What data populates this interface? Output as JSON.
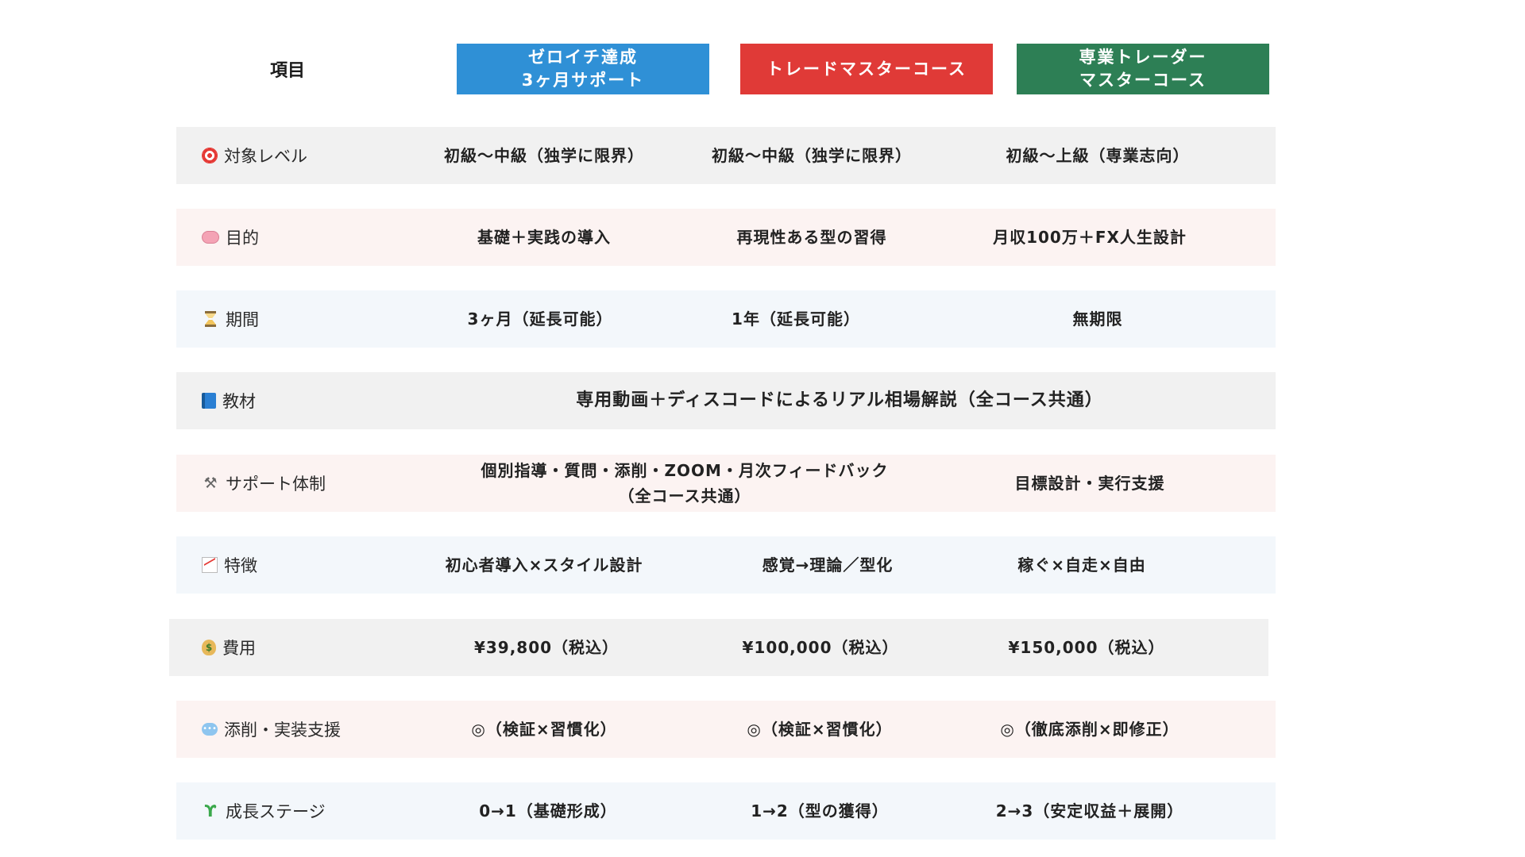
{
  "header": {
    "label": "項目",
    "courses": [
      {
        "title": "ゼロイチ達成\n3ヶ月サポート",
        "color": "#2f90d6"
      },
      {
        "title": "トレードマスターコース",
        "color": "#e03a37"
      },
      {
        "title": "専業トレーダー\nマスターコース",
        "color": "#2d7f55"
      }
    ]
  },
  "rows": [
    {
      "icon": "target-icon",
      "label": "対象レベル",
      "cells": [
        "初級〜中級（独学に限界）",
        "初級〜中級（独学に限界）",
        "初級〜上級（専業志向）"
      ]
    },
    {
      "icon": "brain-icon",
      "label": "目的",
      "cells": [
        "基礎＋実践の導入",
        "再現性ある型の習得",
        "月収100万＋FX人生設計"
      ]
    },
    {
      "icon": "hourglass-icon",
      "label": "期間",
      "cells": [
        "3ヶ月（延長可能）",
        "1年（延長可能）",
        "無期限"
      ]
    },
    {
      "icon": "book-icon",
      "label": "教材",
      "span": "専用動画＋ディスコードによるリアル相場解説（全コース共通）"
    },
    {
      "icon": "tools-icon",
      "label": "サポート体制",
      "span": "個別指導・質問・添削・ZOOM・月次フィードバック\n（全コース共通）",
      "extra": "目標設計・実行支援"
    },
    {
      "icon": "chart-increasing-icon",
      "label": "特徴",
      "cells": [
        "初心者導入×スタイル設計",
        "感覚→理論／型化",
        "稼ぐ×自走×自由"
      ]
    },
    {
      "icon": "money-bag-icon",
      "label": "費用",
      "cells": [
        "¥39,800（税込）",
        "¥100,000（税込）",
        "¥150,000（税込）"
      ]
    },
    {
      "icon": "speech-balloon-icon",
      "label": "添削・実装支援",
      "cells": [
        "◎（検証×習慣化）",
        "◎（検証×習慣化）",
        "◎（徹底添削×即修正）"
      ]
    },
    {
      "icon": "seedling-icon",
      "label": "成長ステージ",
      "cells": [
        "0→1（基礎形成）",
        "1→2（型の獲得）",
        "2→3（安定収益＋展開）"
      ]
    }
  ]
}
